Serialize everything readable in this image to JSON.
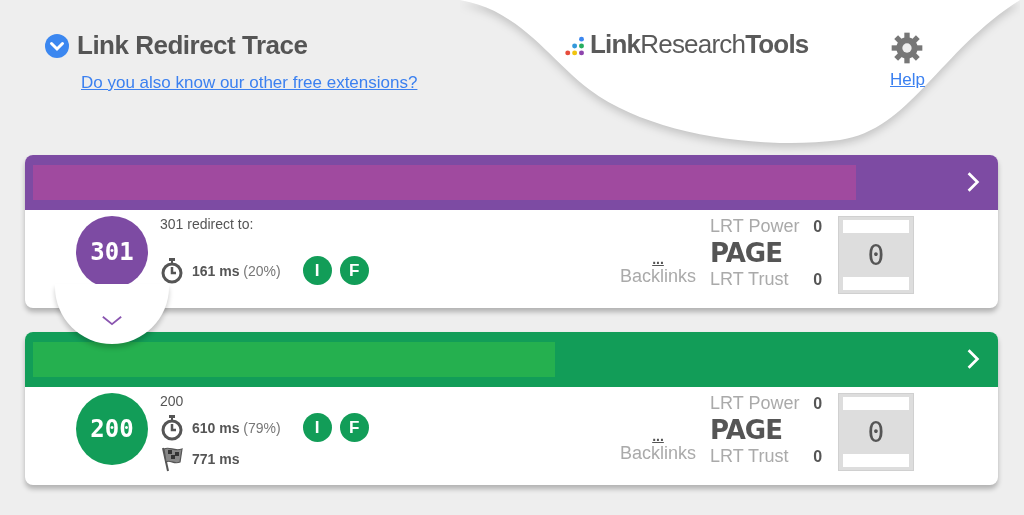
{
  "header": {
    "title": "Link Redirect Trace",
    "extensions_link": "Do you also know our other free extensions?",
    "logo": "**Link**Research**Tools**",
    "help_link": "Help"
  },
  "hops": [
    {
      "status": "301",
      "color": "#7d4ba3",
      "level": 0.86,
      "kind": "redirect",
      "label": "301 redirect to:",
      "time": "161 ms",
      "share": "(20%)",
      "badges": [
        "I",
        "F"
      ],
      "backlinks": "...",
      "backlinks_label": "Backlinks",
      "power_label": "LRT Power",
      "power": "0",
      "page_label": "PAGE",
      "trust_label": "LRT Trust",
      "trust": "0",
      "score": "0",
      "expand_toggle": true
    },
    {
      "status": "200",
      "color": "#129d58",
      "level": 0.545,
      "kind": "final",
      "label": "200",
      "time": "610 ms",
      "share": "(79%)",
      "badges": [
        "I",
        "F"
      ],
      "total_time": "771 ms",
      "backlinks": "...",
      "backlinks_label": "Backlinks",
      "power_label": "LRT Power",
      "power": "0",
      "page_label": "PAGE",
      "trust_label": "LRT Trust",
      "trust": "0",
      "score": "0",
      "expand_toggle": false
    }
  ]
}
